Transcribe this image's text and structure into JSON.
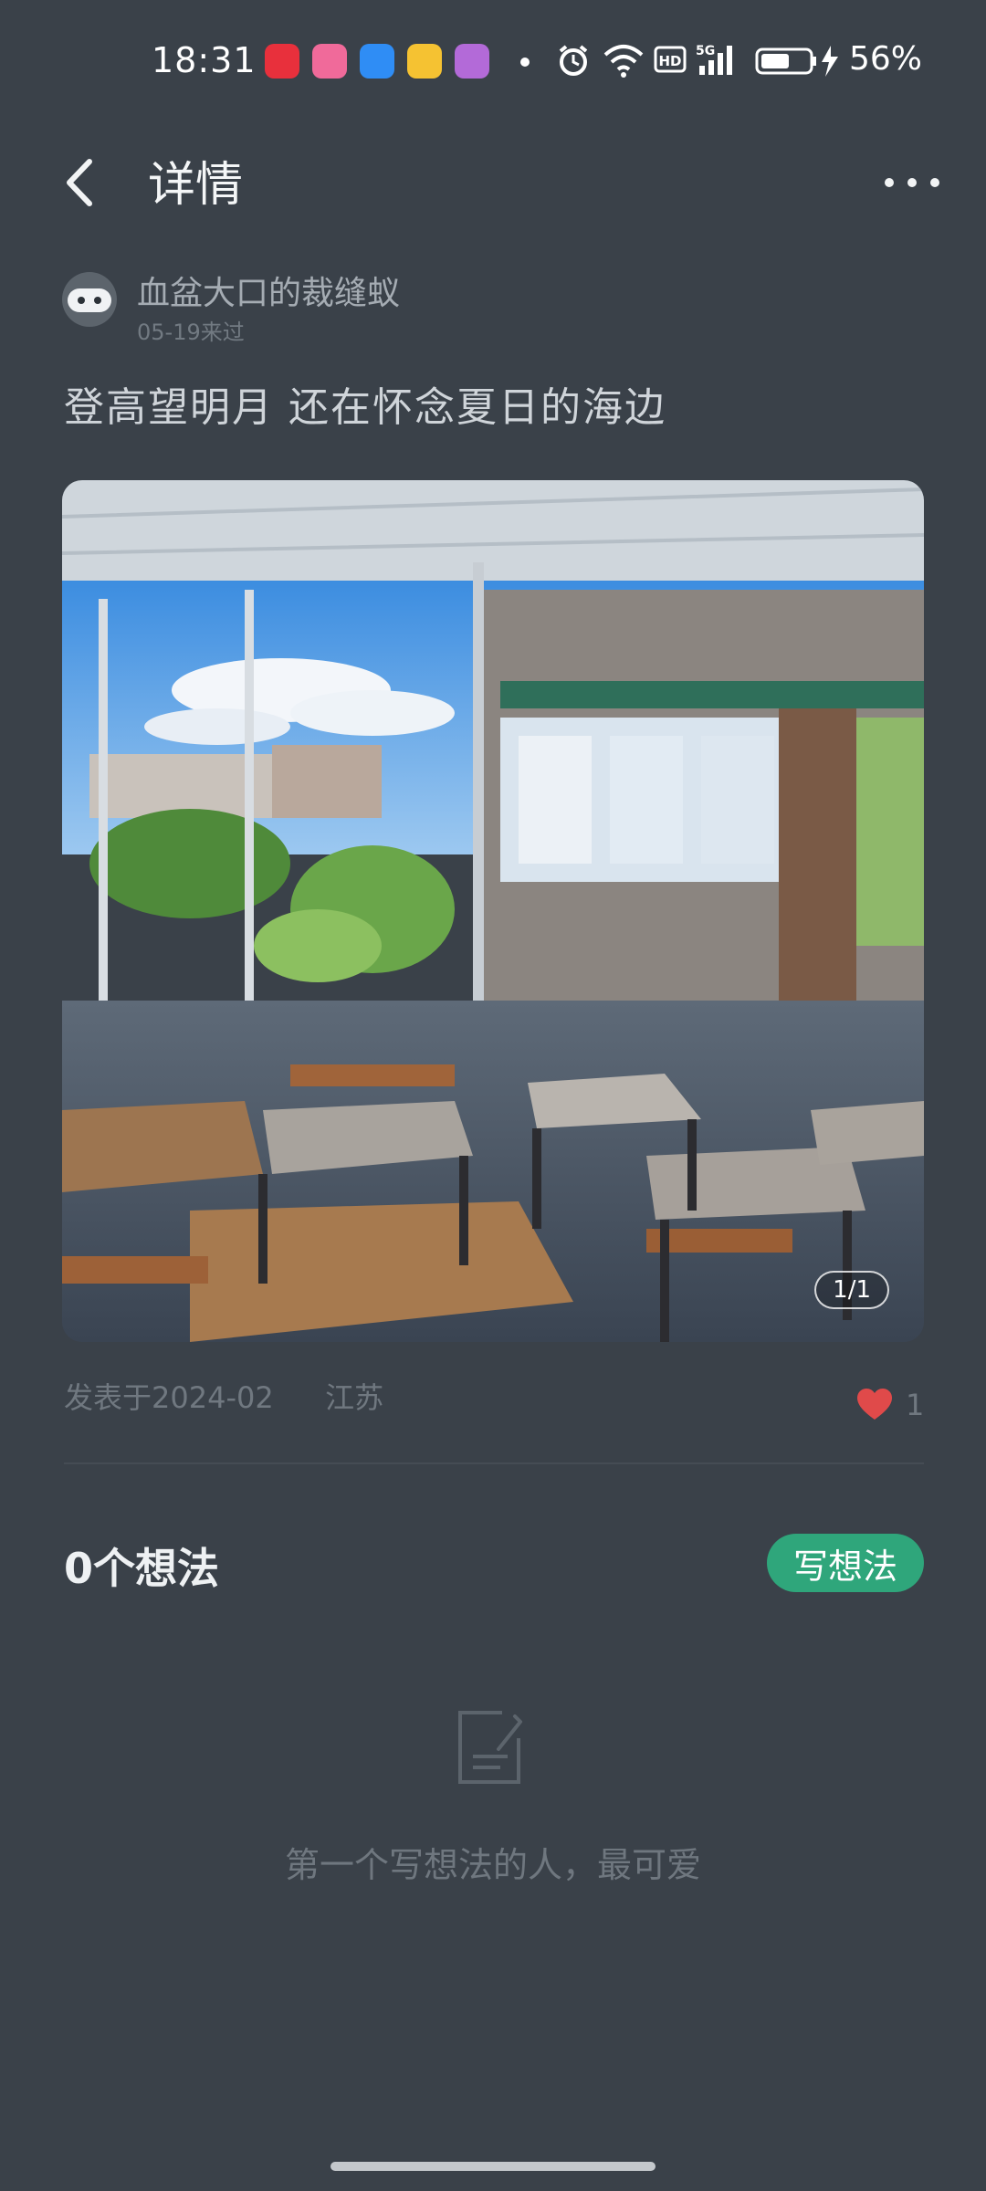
{
  "status_bar": {
    "time": "18:31",
    "battery_percent": "56%",
    "app_icons": [
      "618-shopping-icon",
      "bilibili-icon",
      "blue-app-icon",
      "notes-app-icon",
      "game-app-icon"
    ]
  },
  "header": {
    "title": "详情"
  },
  "author": {
    "name": "血盆大口的裁缝蚁",
    "visit": "05-19来过"
  },
  "post": {
    "text": "登高望明月 还在怀念夏日的海边",
    "photo_counter": "1/1",
    "published": "发表于2024-02",
    "location": "江苏",
    "likes": "1"
  },
  "thoughts": {
    "count_label": "0个想法",
    "write_button": "写想法",
    "empty_text": "第一个写想法的人，最可爱"
  },
  "colors": {
    "background": "#3a4149",
    "accent": "#2fa67b",
    "like_heart": "#e04a4a"
  }
}
